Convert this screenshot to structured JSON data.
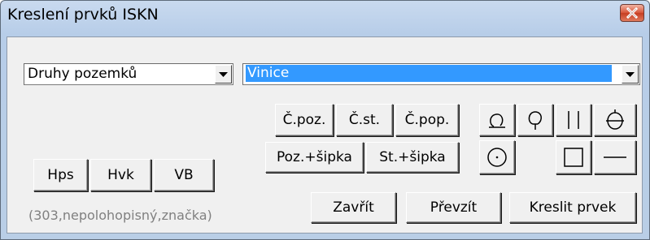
{
  "window": {
    "title": "Kreslení prvků ISKN"
  },
  "combos": {
    "category": "Druhy pozemků",
    "value": "Vinice"
  },
  "buttons": {
    "c_poz": "Č.poz.",
    "c_st": "Č.st.",
    "c_pop": "Č.pop.",
    "poz_sipka": "Poz.+šipka",
    "st_sipka": "St.+šipka",
    "hps": "Hps",
    "hvk": "Hvk",
    "vb": "VB",
    "zavrit": "Zavřít",
    "prevzit": "Převzít",
    "kreslit": "Kreslit prvek"
  },
  "hint": "(303,nepolohopisný,značka)",
  "icons": [
    "loop-down-line-icon",
    "loop-up-line-icon",
    "double-vertical-line-icon",
    "circle-crossed-icon",
    "circle-dot-icon",
    "square-icon",
    "horizontal-line-icon"
  ]
}
